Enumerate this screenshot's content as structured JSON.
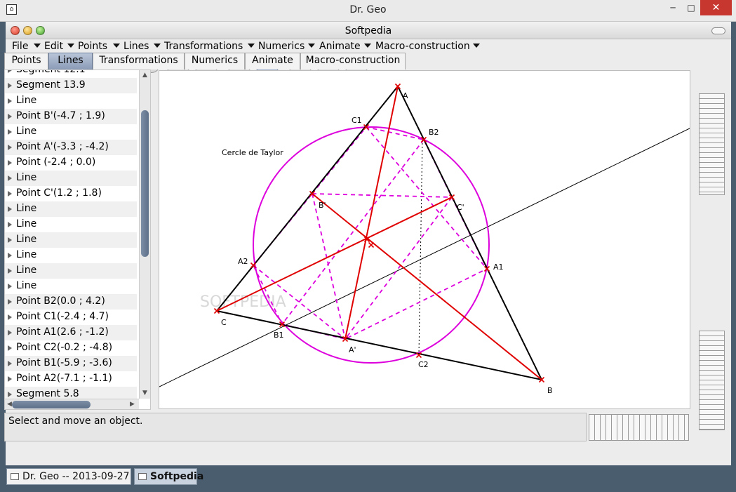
{
  "os_window": {
    "title": "Dr. Geo",
    "minimize_icon": "─",
    "maximize_icon": "□",
    "close_icon": "✕"
  },
  "app_window": {
    "title": "Softpedia"
  },
  "menu": [
    "File",
    "Edit",
    "Points",
    "Lines",
    "Transformations",
    "Numerics",
    "Animate",
    "Macro-construction"
  ],
  "toolbar_icons": [
    "new-icon",
    "open-icon",
    "save-icon",
    "undo-icon",
    "redo-icon",
    "grid-icon",
    "magnet-icon",
    "dots-icon",
    "move-icon",
    "eraser-icon",
    "style-icon",
    "preferences-icon"
  ],
  "tabs": [
    "Points",
    "Lines",
    "Transformations",
    "Numerics",
    "Animate",
    "Macro-construction"
  ],
  "active_tab": "Lines",
  "tree_items": [
    "Segment  12.1",
    "Segment  13.9",
    "Line",
    "Point  B'(-4.7 ; 1.9)",
    "Line",
    "Point A'(-3.3 ; -4.2)",
    "Point  (-2.4 ; 0.0)",
    "Line",
    "Point C'(1.2 ; 1.8)",
    "Line",
    "Line",
    "Line",
    "Line",
    "Line",
    "Line",
    "Point B2(0.0 ; 4.2)",
    "Point C1(-2.4 ; 4.7)",
    "Point A1(2.6 ; -1.2)",
    "Point C2(-0.2 ; -4.8)",
    "Point B1(-5.9 ; -3.6)",
    "Point A2(-7.1 ; -1.1)",
    "Segment  5.8"
  ],
  "canvas": {
    "circle_label": "Cercle de Taylor",
    "watermark": "SOFTPEDIA",
    "point_labels": {
      "A": "A",
      "B": "B",
      "C": "C",
      "A1": "A1",
      "A2": "A2",
      "B1": "B1",
      "B2": "B2",
      "C1": "C1",
      "C2": "C2",
      "Ap": "A'",
      "Bp": "B'",
      "Cp": "C'"
    },
    "colors": {
      "triangle": "#000000",
      "circle": "#dd00dd",
      "red": "#e00000",
      "thin": "#000000"
    }
  },
  "status": {
    "message": "Select and move an object."
  },
  "taskbar": {
    "item1": "Dr. Geo --  2013-09-27",
    "item2": "Softpedia"
  }
}
